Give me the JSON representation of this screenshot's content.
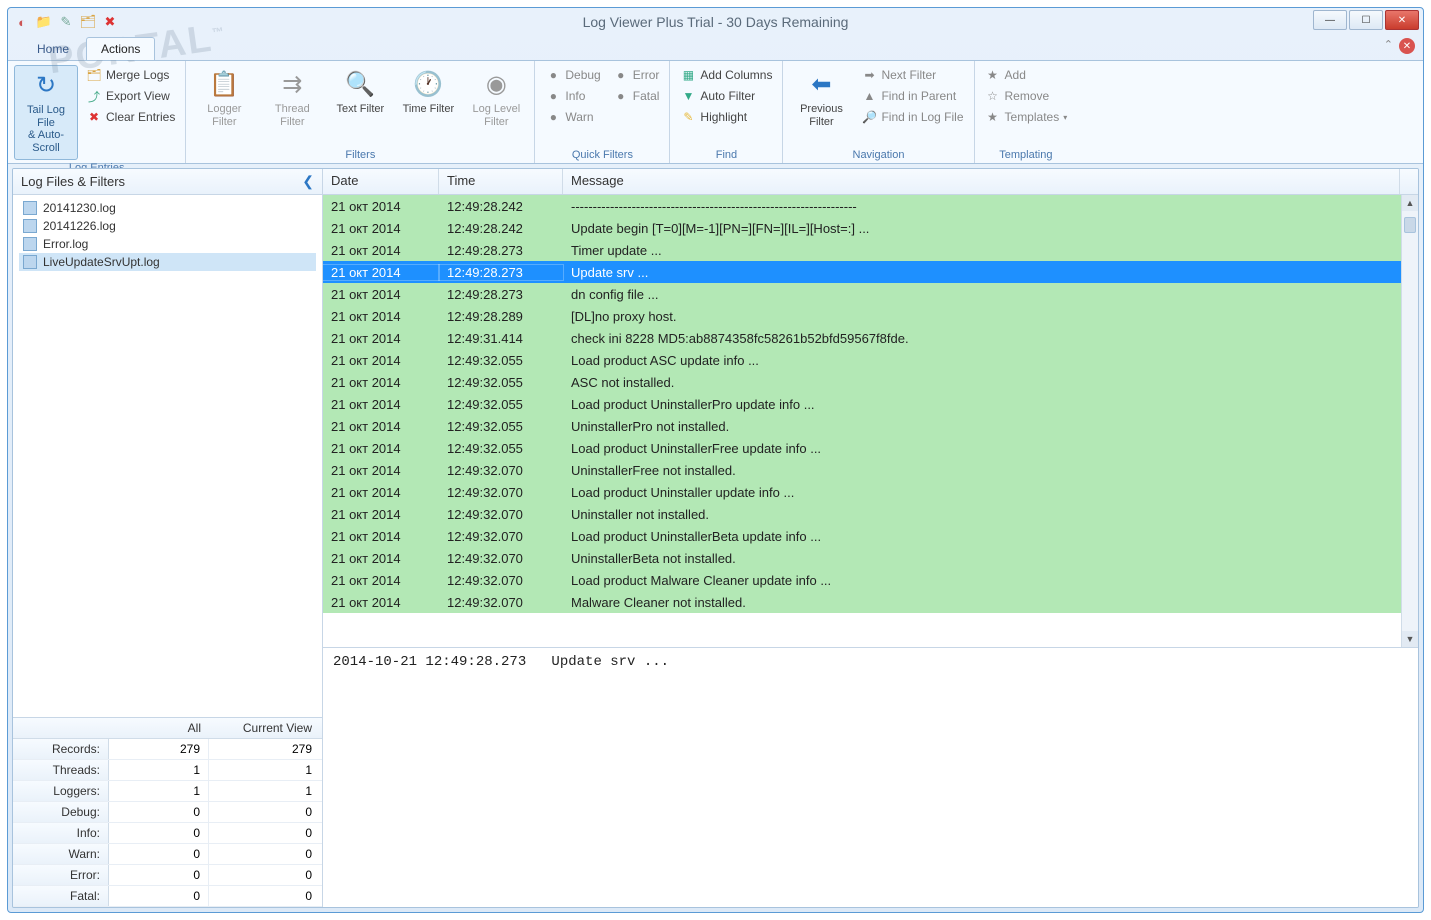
{
  "window": {
    "title": "Log Viewer Plus Trial - 30 Days Remaining"
  },
  "watermark": "PORTAL",
  "tabs": {
    "home": "Home",
    "actions": "Actions"
  },
  "ribbon": {
    "log_entries": {
      "label": "Log Entries",
      "tail": "Tail Log File\n& Auto-Scroll",
      "merge": "Merge Logs",
      "export": "Export View",
      "clear": "Clear Entries"
    },
    "filters": {
      "label": "Filters",
      "logger": "Logger\nFilter",
      "thread": "Thread\nFilter",
      "text": "Text Filter",
      "time": "Time Filter",
      "level": "Log Level\nFilter"
    },
    "quick_filters": {
      "label": "Quick Filters",
      "debug": "Debug",
      "info": "Info",
      "warn": "Warn",
      "error": "Error",
      "fatal": "Fatal"
    },
    "find": {
      "label": "Find",
      "add_columns": "Add Columns",
      "auto_filter": "Auto Filter",
      "highlight": "Highlight"
    },
    "navigation": {
      "label": "Navigation",
      "previous": "Previous\nFilter",
      "next": "Next Filter",
      "parent": "Find in Parent",
      "logfile": "Find in Log File"
    },
    "templating": {
      "label": "Templating",
      "add": "Add",
      "remove": "Remove",
      "templates": "Templates"
    }
  },
  "left": {
    "header": "Log Files & Filters",
    "files": [
      "20141230.log",
      "20141226.log",
      "Error.log",
      "LiveUpdateSrvUpt.log"
    ],
    "selected_index": 3
  },
  "grid": {
    "headers": {
      "date": "Date",
      "time": "Time",
      "message": "Message"
    },
    "selected_index": 3,
    "rows": [
      {
        "date": "21 окт 2014",
        "time": "12:49:28.242",
        "msg": "------------------------------------------------------------------"
      },
      {
        "date": "21 окт 2014",
        "time": "12:49:28.242",
        "msg": "Update begin [T=0][M=-1][PN=][FN=][IL=][Host=:] ..."
      },
      {
        "date": "21 окт 2014",
        "time": "12:49:28.273",
        "msg": "Timer update ..."
      },
      {
        "date": "21 окт 2014",
        "time": "12:49:28.273",
        "msg": "Update srv ..."
      },
      {
        "date": "21 окт 2014",
        "time": "12:49:28.273",
        "msg": "dn config file ..."
      },
      {
        "date": "21 окт 2014",
        "time": "12:49:28.289",
        "msg": "[DL]no proxy host."
      },
      {
        "date": "21 окт 2014",
        "time": "12:49:31.414",
        "msg": "check ini 8228 MD5:ab8874358fc58261b52bfd59567f8fde."
      },
      {
        "date": "21 окт 2014",
        "time": "12:49:32.055",
        "msg": "Load product ASC update info ..."
      },
      {
        "date": "21 окт 2014",
        "time": "12:49:32.055",
        "msg": "ASC not installed."
      },
      {
        "date": "21 окт 2014",
        "time": "12:49:32.055",
        "msg": "Load product UninstallerPro update info ..."
      },
      {
        "date": "21 окт 2014",
        "time": "12:49:32.055",
        "msg": "UninstallerPro not installed."
      },
      {
        "date": "21 окт 2014",
        "time": "12:49:32.055",
        "msg": "Load product UninstallerFree update info ..."
      },
      {
        "date": "21 окт 2014",
        "time": "12:49:32.070",
        "msg": "UninstallerFree not installed."
      },
      {
        "date": "21 окт 2014",
        "time": "12:49:32.070",
        "msg": "Load product Uninstaller update info ..."
      },
      {
        "date": "21 окт 2014",
        "time": "12:49:32.070",
        "msg": "Uninstaller not installed."
      },
      {
        "date": "21 окт 2014",
        "time": "12:49:32.070",
        "msg": "Load product UninstallerBeta update info ..."
      },
      {
        "date": "21 окт 2014",
        "time": "12:49:32.070",
        "msg": "UninstallerBeta not installed."
      },
      {
        "date": "21 окт 2014",
        "time": "12:49:32.070",
        "msg": "Load product Malware Cleaner update info ..."
      },
      {
        "date": "21 окт 2014",
        "time": "12:49:32.070",
        "msg": "Malware Cleaner not installed."
      }
    ]
  },
  "detail": "2014-10-21 12:49:28.273   Update srv ...",
  "stats": {
    "header": {
      "label": "",
      "all": "All",
      "current": "Current View"
    },
    "rows": [
      {
        "label": "Records:",
        "all": "279",
        "cur": "279"
      },
      {
        "label": "Threads:",
        "all": "1",
        "cur": "1"
      },
      {
        "label": "Loggers:",
        "all": "1",
        "cur": "1"
      },
      {
        "label": "Debug:",
        "all": "0",
        "cur": "0"
      },
      {
        "label": "Info:",
        "all": "0",
        "cur": "0"
      },
      {
        "label": "Warn:",
        "all": "0",
        "cur": "0"
      },
      {
        "label": "Error:",
        "all": "0",
        "cur": "0"
      },
      {
        "label": "Fatal:",
        "all": "0",
        "cur": "0"
      }
    ]
  }
}
